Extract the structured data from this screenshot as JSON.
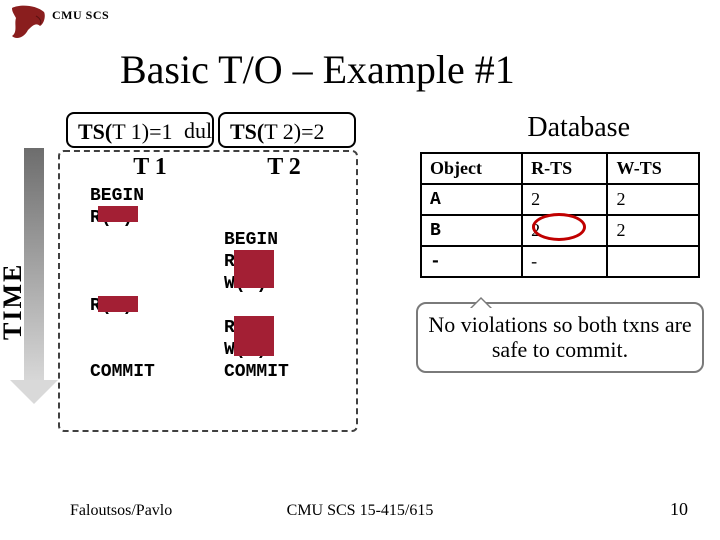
{
  "header": {
    "cmuScs": "CMU SCS"
  },
  "title": "Basic T/O – Example #1",
  "ts": {
    "t1_prefix": "TS(",
    "t1_mid": "T 1",
    "t1_suffix": ")=1",
    "between": "dul",
    "t2_prefix": "TS(",
    "t2_mid": "T 2",
    "t2_suffix": ")=2"
  },
  "databaseLabel": "Database",
  "timeLabel": "TIME",
  "schedule": {
    "t1_header": "T 1",
    "t2_header": "T 2",
    "t1_lines": "BEGIN\nR(B)\n\n\n\nR(A)\n\n\nCOMMIT",
    "t2_lines": "\n\nBEGIN\nR(B)\nW(B)\n\nR(A)\nW(A)\nCOMMIT"
  },
  "chart_data": {
    "type": "table",
    "title": "Database",
    "columns": [
      "Object",
      "R-TS",
      "W-TS"
    ],
    "rows": [
      {
        "Object": "A",
        "R-TS": "2",
        "W-TS": "2"
      },
      {
        "Object": "B",
        "R-TS": "2",
        "W-TS": "2"
      },
      {
        "Object": "-",
        "R-TS": "-",
        "W-TS": ""
      }
    ],
    "highlight": {
      "row": 1,
      "col": "R-TS"
    }
  },
  "callout": "No violations so both txns are safe to commit.",
  "footer": {
    "left": "Faloutsos/Pavlo",
    "center": "CMU SCS 15-415/615",
    "right": "10"
  }
}
